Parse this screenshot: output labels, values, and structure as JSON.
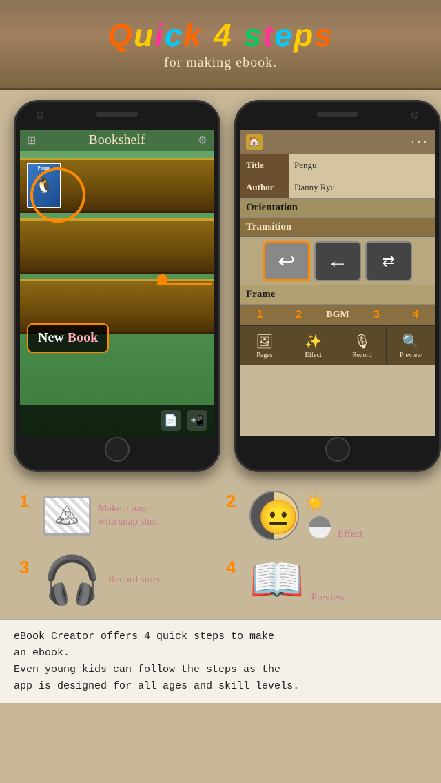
{
  "banner": {
    "title_html": "Quick 4 steps",
    "subtitle": "for making ebook.",
    "title_q": "Q",
    "title_u": "u",
    "title_i": "i",
    "title_c": "c",
    "title_k": "k",
    "title_4": "4",
    "title_s": "s",
    "title_t": "t",
    "title_e": "e",
    "title_p": "p",
    "title_ps": "s"
  },
  "left_phone": {
    "header": "Bookshelf",
    "new_book_label": "New",
    "new_book_label2": " Book"
  },
  "right_phone": {
    "title_label": "Title",
    "title_value": "Pengu",
    "author_label": "Author",
    "author_value": "Danny Ryu",
    "orientation_label": "Orientation",
    "transition_label": "Transition",
    "frame_label": "Frame",
    "bgm_label": "BGM",
    "tab_numbers": [
      "1",
      "2",
      "3",
      "4"
    ],
    "tabs": [
      {
        "label": "Pages",
        "icon": "🖼"
      },
      {
        "label": "Effect",
        "icon": "✨"
      },
      {
        "label": "Record",
        "icon": "🎙"
      },
      {
        "label": "Preview",
        "icon": "🔍"
      }
    ],
    "transition_options": [
      "↩",
      "←",
      "⇄"
    ]
  },
  "steps": [
    {
      "number": "1",
      "label": "Make a page\nwith snap shot"
    },
    {
      "number": "2",
      "label": "Effect"
    },
    {
      "number": "3",
      "label": "Record story"
    },
    {
      "number": "4",
      "label": "Preview"
    }
  ],
  "description": {
    "line1": "eBook Creator offers 4 quick steps to make",
    "line2": "an ebook.",
    "line3": "Even young kids can follow the steps as the",
    "line4": "app is designed for all ages and skill levels."
  }
}
